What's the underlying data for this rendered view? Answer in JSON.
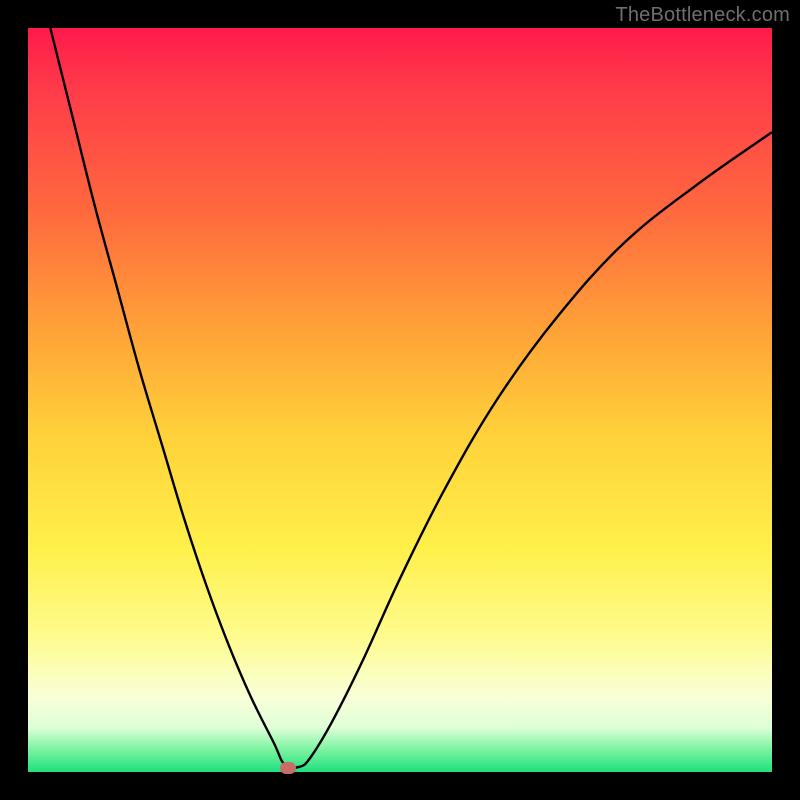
{
  "watermark": "TheBottleneck.com",
  "gradient_colors": {
    "top": "#ff1a4b",
    "mid_upper": "#ffa038",
    "mid": "#fff04a",
    "mid_lower": "#f8ffd8",
    "bottom": "#1ee07e"
  },
  "curve_color": "#000000",
  "marker_color": "#c96d68",
  "chart_data": {
    "type": "line",
    "title": "",
    "xlabel": "",
    "ylabel": "",
    "xlim": [
      0,
      100
    ],
    "ylim": [
      0,
      100
    ],
    "series": [
      {
        "name": "bottleneck-curve",
        "x": [
          3,
          6,
          9,
          12,
          15,
          18,
          21,
          24,
          27,
          30,
          33,
          34.5,
          36.5,
          38,
          41,
          45,
          50,
          56,
          63,
          71,
          80,
          90,
          100
        ],
        "y": [
          100,
          88,
          76,
          65,
          54,
          44,
          34,
          25,
          17,
          10,
          4,
          1,
          0.7,
          2,
          7,
          15,
          26,
          38,
          50,
          61,
          71,
          79,
          86
        ]
      }
    ],
    "annotations": [
      {
        "name": "optimal-marker",
        "x": 35,
        "y": 0.5
      }
    ]
  }
}
